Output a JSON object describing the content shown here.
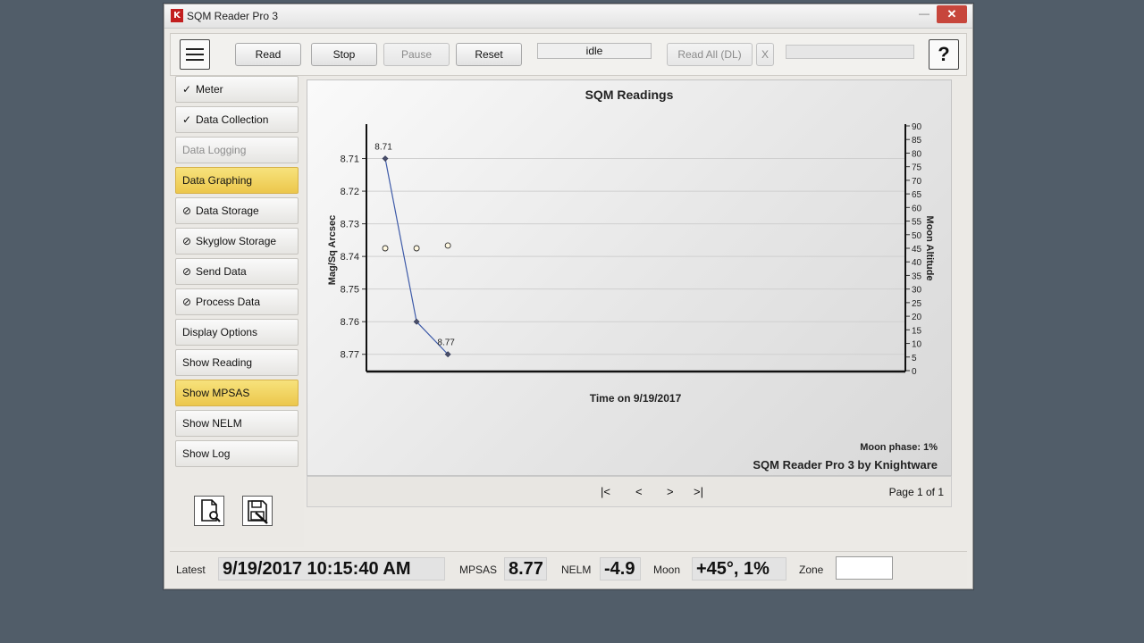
{
  "window": {
    "title": "SQM Reader Pro 3",
    "app_icon": "K"
  },
  "toolbar": {
    "read_label": "Read",
    "stop_label": "Stop",
    "pause_label": "Pause",
    "reset_label": "Reset",
    "status": "idle",
    "read_all_label": "Read All (DL)",
    "cancel_label": "X",
    "help_label": "?",
    "progress_fraction": 0
  },
  "sidebar": {
    "items": [
      {
        "label": "Meter",
        "icon": "check-circle-icon",
        "glyph": "⊘"
      },
      {
        "label": "Data Collection",
        "icon": "check-circle-icon",
        "glyph": "⊘"
      },
      {
        "label": "Data Logging",
        "icon": "",
        "glyph": ""
      },
      {
        "label": "Data Graphing",
        "icon": "",
        "glyph": ""
      },
      {
        "label": "Data Storage",
        "icon": "no-entry-icon",
        "glyph": "⊘"
      },
      {
        "label": "Skyglow Storage",
        "icon": "no-entry-icon",
        "glyph": "⊘"
      },
      {
        "label": "Send Data",
        "icon": "no-entry-icon",
        "glyph": "⊘"
      },
      {
        "label": "Process Data",
        "icon": "no-entry-icon",
        "glyph": "⊘"
      },
      {
        "label": "Display Options",
        "icon": "",
        "glyph": ""
      },
      {
        "label": "Show Reading",
        "icon": "",
        "glyph": ""
      },
      {
        "label": "Show MPSAS",
        "icon": "",
        "glyph": ""
      },
      {
        "label": "Show NELM",
        "icon": "",
        "glyph": ""
      },
      {
        "label": "Show Log",
        "icon": "",
        "glyph": ""
      }
    ],
    "active_color": "#ecc74c"
  },
  "chart_data": {
    "type": "line",
    "title": "SQM Readings",
    "xlabel": "Time on 9/19/2017",
    "ylabel": "Mag/Sq Arcsec",
    "y2label": "Moon Altitude",
    "ylim": [
      8.7,
      8.775
    ],
    "yticks": [
      8.71,
      8.72,
      8.73,
      8.74,
      8.75,
      8.76,
      8.77
    ],
    "y2lim": [
      0,
      90
    ],
    "y2ticks": [
      0,
      5,
      10,
      15,
      20,
      25,
      30,
      35,
      40,
      45,
      50,
      55,
      60,
      65,
      70,
      75,
      80,
      85,
      90
    ],
    "series": [
      {
        "values": [
          8.71,
          8.76,
          8.77
        ],
        "data_labels": [
          "8.71",
          "",
          "8.77"
        ],
        "color": "#3d5aa8"
      },
      {
        "values": [
          45,
          45,
          46
        ],
        "axis": "right",
        "marker": "circle-open",
        "color": "#e8a33a"
      }
    ],
    "x_index": [
      0,
      1,
      2
    ],
    "grid": true,
    "moon_phase": "Moon phase: 1%",
    "credit": "SQM Reader Pro 3 by Knightware"
  },
  "pager": {
    "first": "|<",
    "prev": "<",
    "next": ">",
    "last": ">|",
    "page_info": "Page 1 of 1"
  },
  "status": {
    "latest_label": "Latest",
    "latest_value": "9/19/2017 10:15:40 AM",
    "mpsas_label": "MPSAS",
    "mpsas_value": "8.77",
    "nelm_label": "NELM",
    "nelm_value": "-4.9",
    "moon_label": "Moon",
    "moon_value": "+45°, 1%",
    "zone_label": "Zone",
    "zone_value": ""
  }
}
